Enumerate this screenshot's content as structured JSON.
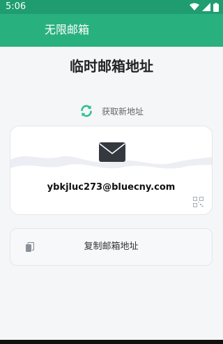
{
  "status_bar": {
    "time": "5:06",
    "icons": [
      "wifi-icon",
      "signal-icon",
      "battery-icon"
    ]
  },
  "app_bar": {
    "title": "无限邮箱"
  },
  "page": {
    "title": "临时邮箱地址"
  },
  "refresh": {
    "label": "获取新地址",
    "icon": "refresh-icon"
  },
  "mail_card": {
    "email": "ybkjluc273@bluecny.com",
    "icons": [
      "envelope-icon",
      "qr-code-icon"
    ]
  },
  "copy_button": {
    "label": "复制邮箱地址",
    "icon": "copy-icon"
  },
  "colors": {
    "primary": "#29b07f",
    "status_bar": "#1f9d71",
    "accent": "#2fbf8a",
    "background": "#f5f6f8"
  }
}
